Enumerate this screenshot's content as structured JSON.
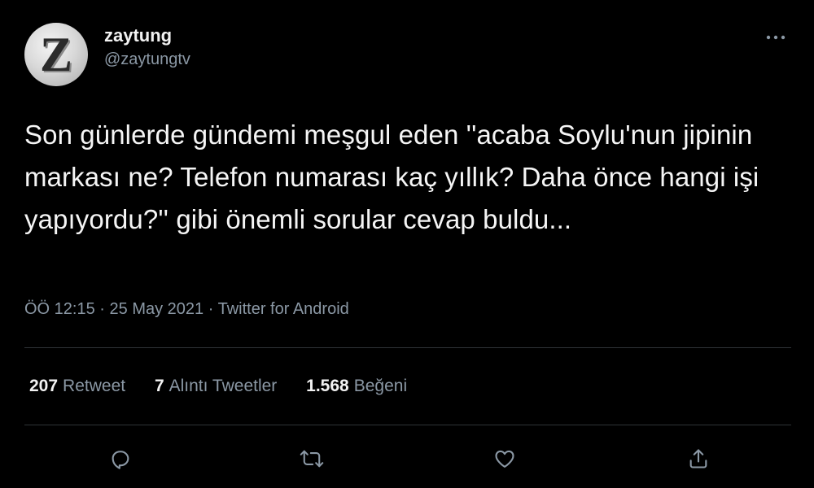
{
  "tweet": {
    "author": {
      "avatar_letter": "Z",
      "display_name": "zaytung",
      "handle": "@zaytungtv"
    },
    "more_icon": "more-horizontal-icon",
    "text": "Son günlerde gündemi meşgul eden ''acaba Soylu'nun jipinin markası ne? Telefon numarası kaç yıllık? Daha önce hangi işi yapıyordu?'' gibi önemli sorular cevap buldu...",
    "meta": {
      "time": "ÖÖ 12:15",
      "separator": "·",
      "date": "25 May 2021",
      "source": "Twitter for Android"
    },
    "stats": {
      "retweets": {
        "count": "207",
        "label": "Retweet"
      },
      "quotes": {
        "count": "7",
        "label": "Alıntı Tweetler"
      },
      "likes": {
        "count": "1.568",
        "label": "Beğeni"
      }
    },
    "actions": [
      {
        "icon": "reply-icon"
      },
      {
        "icon": "retweet-icon"
      },
      {
        "icon": "like-icon"
      },
      {
        "icon": "share-icon"
      }
    ]
  },
  "colors": {
    "background": "#000000",
    "text_primary": "#f5f5f5",
    "text_secondary": "#8b98a5",
    "divider": "#2f3336"
  }
}
